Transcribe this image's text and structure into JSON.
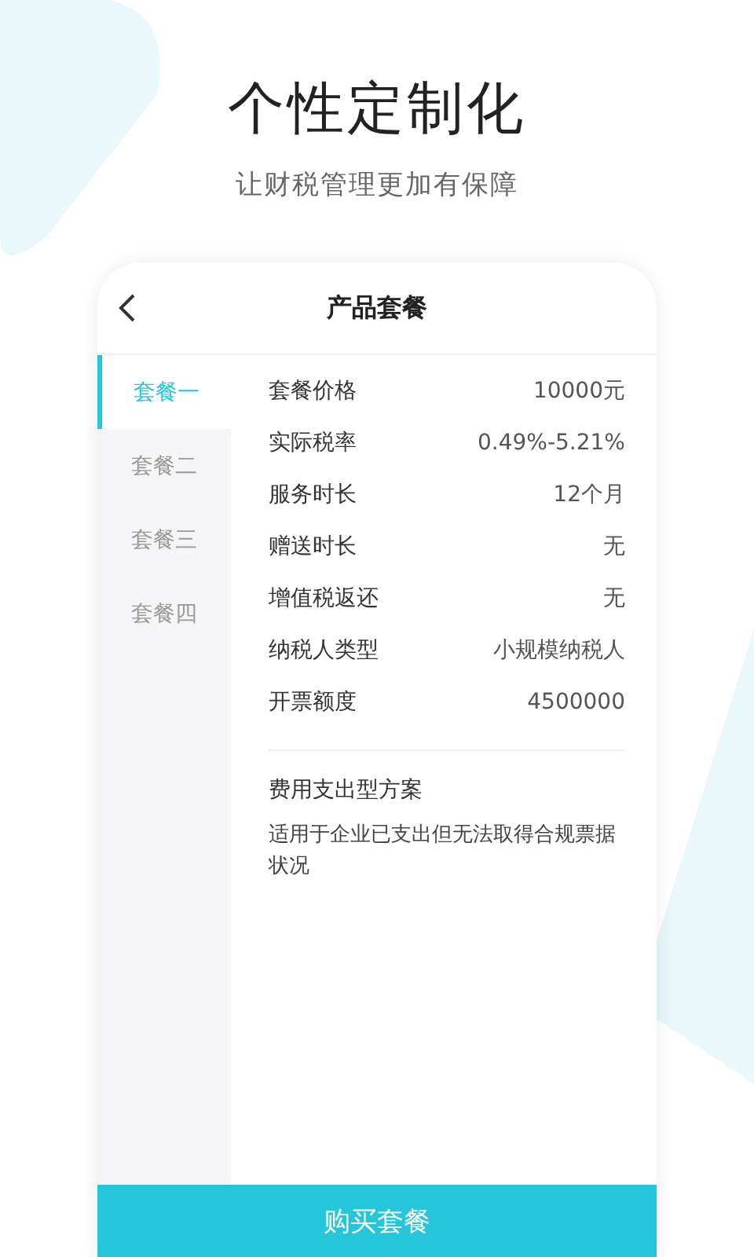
{
  "headline": "个性定制化",
  "subtitle": "让财税管理更加有保障",
  "screen": {
    "title": "产品套餐",
    "packages": [
      {
        "label": "套餐一",
        "selected": true
      },
      {
        "label": "套餐二",
        "selected": false
      },
      {
        "label": "套餐三",
        "selected": false
      },
      {
        "label": "套餐四",
        "selected": false
      }
    ],
    "details": [
      {
        "label": "套餐价格",
        "value": "10000元"
      },
      {
        "label": "实际税率",
        "value": "0.49%-5.21%"
      },
      {
        "label": "服务时长",
        "value": "12个月"
      },
      {
        "label": "赠送时长",
        "value": "无"
      },
      {
        "label": "增值税返还",
        "value": "无"
      },
      {
        "label": "纳税人类型",
        "value": "小规模纳税人"
      },
      {
        "label": "开票额度",
        "value": "4500000"
      }
    ],
    "plan_title": "费用支出型方案",
    "plan_description": "适用于企业已支出但无法取得合规票据状况",
    "buy_button": "购买套餐"
  }
}
